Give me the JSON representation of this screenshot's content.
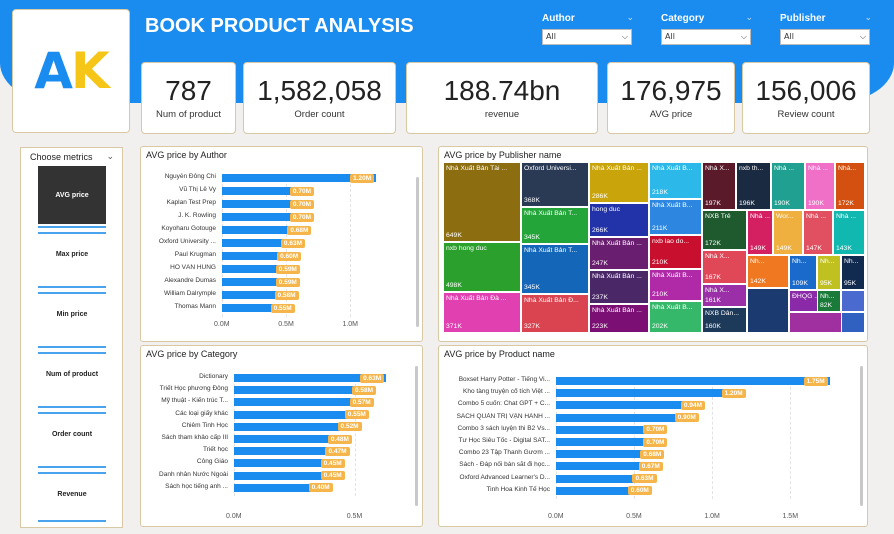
{
  "header": {
    "title": "BOOK PRODUCT ANALYSIS",
    "logo_a": "A",
    "logo_k": "K"
  },
  "filters": [
    {
      "label": "Author",
      "value": "All"
    },
    {
      "label": "Category",
      "value": "All"
    },
    {
      "label": "Publisher",
      "value": "All"
    }
  ],
  "kpis": [
    {
      "value": "787",
      "label": "Num of product"
    },
    {
      "value": "1,582,058",
      "label": "Order count"
    },
    {
      "value": "188.74bn",
      "label": "revenue"
    },
    {
      "value": "176,975",
      "label": "AVG price"
    },
    {
      "value": "156,006",
      "label": "Review count"
    }
  ],
  "metrics": {
    "title": "Choose metrics",
    "items": [
      "AVG price",
      "Max price",
      "Min price",
      "Num of product",
      "Order count",
      "Revenue"
    ],
    "selected": "AVG price"
  },
  "colors": {
    "accent": "#1a8cf0",
    "label": "#f5b54a",
    "logo_k": "#f5c518"
  },
  "chart_data": [
    {
      "type": "bar",
      "title": "AVG price by Author",
      "categories": [
        "Nguyễn Đông Chi",
        "Vũ Thị Lê Vy",
        "Kaplan Test Prep",
        "J. K. Rowling",
        "Koyoharu Gotouge",
        "Oxford University ...",
        "Paul Krugman",
        "HỒ VĂN HÙNG",
        "Alexandre Dumas",
        "William Dalrymple",
        "Thomas Mann"
      ],
      "values": [
        1200000,
        700000,
        700000,
        700000,
        680000,
        630000,
        600000,
        590000,
        590000,
        580000,
        550000
      ],
      "value_labels": [
        "1.20M",
        "0.70M",
        "0.70M",
        "0.70M",
        "0.68M",
        "0.63M",
        "0.60M",
        "0.59M",
        "0.59M",
        "0.58M",
        "0.55M"
      ],
      "xticks": [
        "0.0M",
        "0.5M",
        "1.0M"
      ],
      "xlim": [
        0,
        1300000
      ]
    },
    {
      "type": "bar",
      "title": "AVG price by Category",
      "categories": [
        "Dictionary",
        "Triết Học phương Đông",
        "Mỹ thuật - Kiến trúc T...",
        "Các loại giấy khác",
        "Chiêm Tinh Học",
        "Sách tham khảo cấp III",
        "Triết học",
        "Công Giáo",
        "Danh nhân Nước Ngoài",
        "Sách học tiếng anh ..."
      ],
      "values": [
        630000,
        580000,
        570000,
        550000,
        520000,
        480000,
        470000,
        450000,
        450000,
        400000
      ],
      "value_labels": [
        "0.63M",
        "0.58M",
        "0.57M",
        "0.55M",
        "0.52M",
        "0.48M",
        "0.47M",
        "0.45M",
        "0.45M",
        "0.40M"
      ],
      "xticks": [
        "0.0M",
        "0.5M"
      ],
      "xlim": [
        0,
        700000
      ]
    },
    {
      "type": "bar",
      "title": "AVG price by Product name",
      "categories": [
        "Boxset Harry Potter - Tiếng Vi...",
        "Kho tàng truyện cổ tích Việt ...",
        "Combo 5 cuốn: Chat GPT + C...",
        "SÁCH QUẢN TRỊ VẬN HÀNH ...",
        "Combo 3 sách luyện thi B2 Vs...",
        "Tư Học Siêu Tốc - Digital SAT...",
        "Combo 23 Tập Thanh Gươm ...",
        "Sách - Đáp nối bàn sắt đi học...",
        "Oxford Advanced Learner's D...",
        "Tinh Hoa Kinh Tế Học"
      ],
      "values": [
        1750000,
        1200000,
        940000,
        900000,
        700000,
        700000,
        680000,
        670000,
        630000,
        600000
      ],
      "value_labels": [
        "1.75M",
        "1.20M",
        "0.94M",
        "0.90M",
        "0.70M",
        "0.70M",
        "0.68M",
        "0.67M",
        "0.63M",
        "0.60M"
      ],
      "xticks": [
        "0.0M",
        "0.5M",
        "1.0M",
        "1.5M"
      ],
      "xlim": [
        0,
        1900000
      ]
    },
    {
      "type": "treemap",
      "title": "AVG price by Publisher name",
      "nodes": [
        {
          "name": "Nhà Xuất Bản Tài ...",
          "value": "649K",
          "color": "#8c6d10"
        },
        {
          "name": "nxb hong duc",
          "value": "498K",
          "color": "#2ca02c"
        },
        {
          "name": "Nhà Xuất Bản Đà ...",
          "value": "371K",
          "color": "#e040b0"
        },
        {
          "name": "Oxford Universi...",
          "value": "368K",
          "color": "#2a3a55"
        },
        {
          "name": "Nhà Xuất Bản T...",
          "value": "345K",
          "color": "#23a53a"
        },
        {
          "name": "Nhà Xuất Bản T...",
          "value": "345K",
          "color": "#1466b8"
        },
        {
          "name": "Nhà Xuất Bản Đ...",
          "value": "327K",
          "color": "#d94450"
        },
        {
          "name": "Nhà Xuất Bản ...",
          "value": "286K",
          "color": "#c9a40a"
        },
        {
          "name": "hong duc",
          "value": "266K",
          "color": "#2233aa"
        },
        {
          "name": "Nhà Xuất Bản ...",
          "value": "247K",
          "color": "#6a1e70"
        },
        {
          "name": "Nhà Xuất Bản ...",
          "value": "237K",
          "color": "#4a2868"
        },
        {
          "name": "Nhà Xuất Bản ...",
          "value": "223K",
          "color": "#7b0f74"
        },
        {
          "name": "Nhà Xuất B...",
          "value": "218K",
          "color": "#2cb8e8"
        },
        {
          "name": "Nhà Xuất B...",
          "value": "211K",
          "color": "#2d86e0"
        },
        {
          "name": "nxb lao do...",
          "value": "210K",
          "color": "#c8102e"
        },
        {
          "name": "Nhà Xuất B...",
          "value": "210K",
          "color": "#b02aa8"
        },
        {
          "name": "Nhà Xuất B...",
          "value": "202K",
          "color": "#36b86a"
        },
        {
          "name": "Nhà X...",
          "value": "197K",
          "color": "#5a1a2a"
        },
        {
          "name": "nxb th...",
          "value": "196K",
          "color": "#1a2a40"
        },
        {
          "name": "Nhà ...",
          "value": "190K",
          "color": "#20a090"
        },
        {
          "name": "Nhà ...",
          "value": "190K",
          "color": "#f070c8"
        },
        {
          "name": "Nhà...",
          "value": "172K",
          "color": "#d45010"
        },
        {
          "name": "NXB Trẻ",
          "value": "172K",
          "color": "#1e5a2e"
        },
        {
          "name": "Nhà X...",
          "value": "167K",
          "color": "#e04858"
        },
        {
          "name": "Nhà X...",
          "value": "161K",
          "color": "#9b2fa8"
        },
        {
          "name": "NXB Dân...",
          "value": "160K",
          "color": "#1e3a5a"
        },
        {
          "name": "Nhà ...",
          "value": "149K",
          "color": "#d42060"
        },
        {
          "name": "Wor...",
          "value": "149K",
          "color": "#f0b040"
        },
        {
          "name": "Nhà ...",
          "value": "147K",
          "color": "#e05060"
        },
        {
          "name": "Nhà ...",
          "value": "143K",
          "color": "#10b8b0"
        },
        {
          "name": "Nh...",
          "value": "142K",
          "color": "#f07820"
        },
        {
          "name": "Nh...",
          "value": "109K",
          "color": "#1a6acc"
        },
        {
          "name": "Nh...",
          "value": "95K",
          "color": "#c0c020"
        },
        {
          "name": "Nh...",
          "value": "95K",
          "color": "#102a50"
        },
        {
          "name": "ĐHQG ...",
          "value": "",
          "color": "#8a2aa8"
        },
        {
          "name": "Nh...",
          "value": "82K",
          "color": "#1a7a3a"
        }
      ]
    }
  ]
}
